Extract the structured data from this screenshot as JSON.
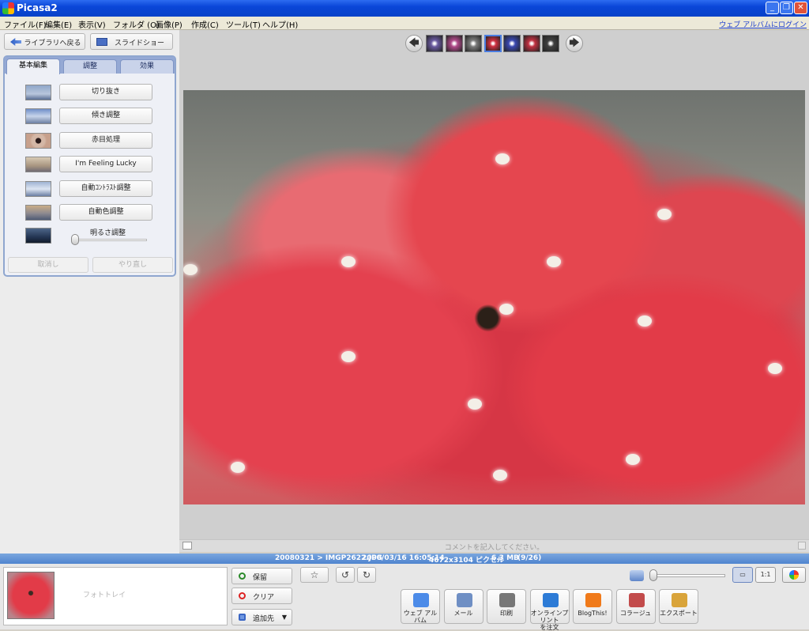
{
  "window": {
    "title": "Picasa2",
    "min_glyph": "_",
    "max_glyph": "❐",
    "close_glyph": "✕"
  },
  "menu": {
    "items": [
      "ファイル(F)",
      "編集(E)",
      "表示(V)",
      "フォルダ (O)",
      "画像(P)",
      "作成(C)",
      "ツール(T)",
      "ヘルプ(H)"
    ],
    "login": "ウェブ アルバムにログイン"
  },
  "left": {
    "back_label": "ライブラリへ戻る",
    "slideshow_label": "スライドショー",
    "tabs": [
      "基本編集",
      "調整",
      "効果"
    ],
    "fixes": [
      "切り抜き",
      "傾き調整",
      "赤目処理",
      "I'm Feeling Lucky",
      "自動ｺﾝﾄﾗｽﾄ調整",
      "自動色調整"
    ],
    "brightness_label": "明るさ調整",
    "brightness_level": 0.0,
    "undo_label": "取消し",
    "redo_label": "やり直し"
  },
  "viewer": {
    "prev_glyph": "🡄",
    "next_glyph": "🡆",
    "thumb_colors": [
      "#6a5aa0",
      "#b04a8a",
      "#7a7a7a",
      "#d03040",
      "#3a48b0",
      "#c03040",
      "#404040"
    ],
    "selected_thumb": 3,
    "comment_placeholder": "コメントを記入してください。"
  },
  "info": {
    "path": "20080321 > IMGP2622.JPG",
    "datetime": "2008/03/16 16:05:14",
    "dimensions": "4672x3104 ピクセル",
    "size": "6.3 MB",
    "index": "(9/26)"
  },
  "tray": {
    "label": "フォトトレイ",
    "hold_label": "保留",
    "clear_label": "クリア",
    "add_label": "追加先",
    "star_glyph": "☆",
    "rotate_left_glyph": "↺",
    "rotate_right_glyph": "↻",
    "actions": [
      "ウェブ アルバム",
      "メール",
      "印刷",
      "オンラインプリント\nを注文",
      "BlogThis!",
      "コラージュ",
      "エクスポート"
    ],
    "action_colors": [
      "#4c8be8",
      "#6f8fc4",
      "#777777",
      "#2d7bd6",
      "#f07a1a",
      "#c24b4b",
      "#d9a43a"
    ],
    "view_labels": [
      "▭",
      "1:1"
    ],
    "zoom_level": 0.0
  }
}
